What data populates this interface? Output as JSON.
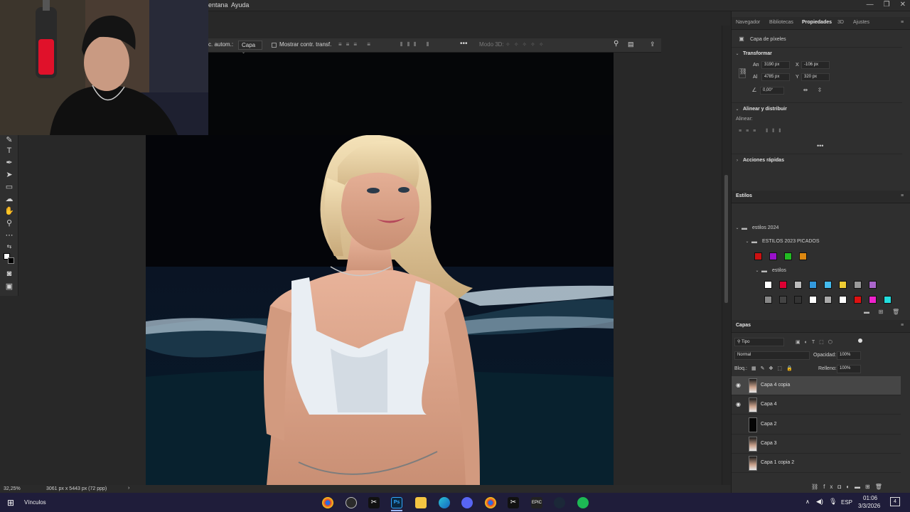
{
  "menubar": {
    "items": [
      "entana",
      "Ayuda"
    ]
  },
  "options_bar": {
    "auto_select_label": "c. autom.:",
    "target_value": "Capa",
    "show_transform_label": "Mostrar contr. transf.",
    "mode3d_label": "Modo 3D:",
    "more": "•••"
  },
  "right_tabs": [
    "Navegador",
    "Bibliotecas",
    "Propiedades",
    "3D",
    "Ajustes"
  ],
  "properties": {
    "layer_type": "Capa de píxeles",
    "transform_title": "Transformar",
    "width_label": "An",
    "width_value": "3190 px",
    "height_label": "Al",
    "height_value": "4785 px",
    "x_label": "X",
    "x_value": "-106 px",
    "y_label": "Y",
    "y_value": "320 px",
    "angle_value": "0,00°",
    "align_title": "Alinear y distribuir",
    "align_label": "Alinear:",
    "quick_actions_title": "Acciones rápidas"
  },
  "styles": {
    "title": "Estilos",
    "folder1": "estilos 2024",
    "folder2": "ESTILOS 2023 PICADOS",
    "folder3": "estilos",
    "row1_colors": [
      "#cc1111",
      "#9a11cc",
      "#22bb22",
      "#dd8811"
    ],
    "row2_colors": [
      "#ffffff",
      "#dd0033",
      "#bbbbbb",
      "#3399dd",
      "#44bbee",
      "#eecc33",
      "#999999",
      "#aa66cc"
    ],
    "row3_colors": [
      "#888888",
      "#444444",
      "#333333",
      "#ffffff",
      "#aaaaaa",
      "#ffffff",
      "#dd1111",
      "#ee22cc",
      "#22dddd"
    ]
  },
  "layers": {
    "title": "Capas",
    "filter": "Tipo",
    "blend_mode": "Normal",
    "opacity_label": "Opacidad:",
    "opacity_value": "100%",
    "lock_label": "Bloq.:",
    "fill_label": "Relleno:",
    "fill_value": "100%",
    "items": [
      {
        "name": "Capa 4 copia",
        "visible": true,
        "selected": true
      },
      {
        "name": "Capa 4",
        "visible": true,
        "selected": false
      },
      {
        "name": "Capa 2",
        "visible": false,
        "selected": false
      },
      {
        "name": "Capa 3",
        "visible": false,
        "selected": false
      },
      {
        "name": "Capa 1 copia 2",
        "visible": false,
        "selected": false
      }
    ]
  },
  "status": {
    "zoom": "32,25%",
    "doc_info": "3061 px x 5443 px (72 ppp)"
  },
  "taskbar": {
    "links_label": "Vínculos",
    "lang": "ESP",
    "time": "01:06",
    "date": "3/3/2026",
    "notif": "4"
  }
}
